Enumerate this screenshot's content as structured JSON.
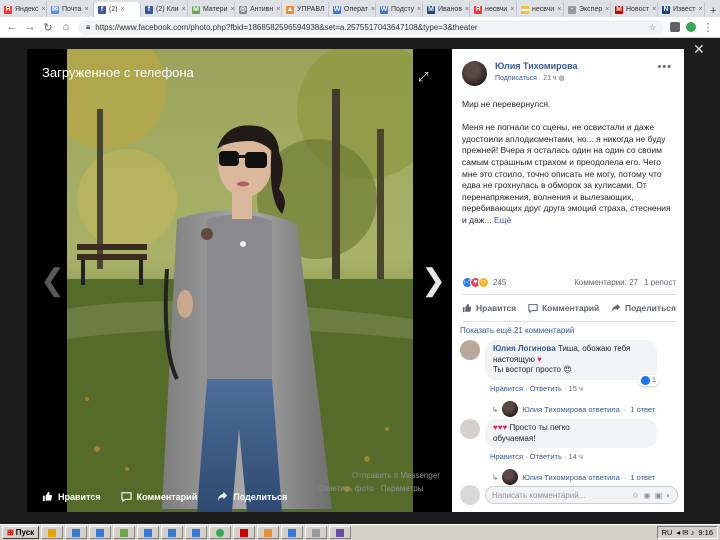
{
  "browser": {
    "tabs": [
      {
        "label": "Яндекс",
        "color": "#ff3333",
        "glyph": "Я"
      },
      {
        "label": "Почта",
        "color": "#5c8ee6",
        "glyph": "✉"
      },
      {
        "label": "(2)",
        "color": "#3b5998",
        "glyph": "f",
        "active": true
      },
      {
        "label": "(2) Кли",
        "color": "#3b5998",
        "glyph": "f"
      },
      {
        "label": "Матери",
        "color": "#6aa84f",
        "glyph": "М"
      },
      {
        "label": "Антивн",
        "color": "#888888",
        "glyph": "◎"
      },
      {
        "label": "УПРАВЛ",
        "color": "#e69138",
        "glyph": "▲"
      },
      {
        "label": "Операт",
        "color": "#3c78d8",
        "glyph": "W"
      },
      {
        "label": "Подсту",
        "color": "#3c78d8",
        "glyph": "W"
      },
      {
        "label": "Иванов",
        "color": "#1c4587",
        "glyph": "M"
      },
      {
        "label": "несвчи",
        "color": "#ff3333",
        "glyph": "Я"
      },
      {
        "label": "несвчи",
        "color": "#f1c232",
        "glyph": "▬"
      },
      {
        "label": "Экспер",
        "color": "#999999",
        "glyph": "·"
      },
      {
        "label": "Новост",
        "color": "#cc0000",
        "glyph": "M"
      },
      {
        "label": "Извест",
        "color": "#1c4587",
        "glyph": "N"
      }
    ],
    "url": "https://www.facebook.com/photo.php?fbid=1868582596594938&set=a.2575517043647108&type=3&theater"
  },
  "viewer": {
    "album_title": "Загруженное с телефона",
    "actions": {
      "like": "Нравится",
      "comment": "Комментарий",
      "share": "Поделиться"
    },
    "meta_send": "Отправить в Messenger",
    "meta_tag": "Отметить фото",
    "meta_options": "Параметры"
  },
  "post": {
    "author": "Юлия Тихомирова",
    "subscribe": "Подписаться",
    "time": "21 ч",
    "paragraph1": "Мир не перевернулся.",
    "paragraph2": "Меня не погнали со сцены, не освистали и даже удостоили аплодисментами, но... я никогда не буду прежней! Вчера я осталась один на один со своим самым страшным страхом и преодолела его. Чего мне это стоило, точно описать не могу, потому что едва не грохнулась в обморок за кулисами. От перенапряжения, волнения и вылезающих, перебивающих друг друга эмоций страха, стеснения и даж...",
    "more_link": "Ещё",
    "reactions_count": "245",
    "comments_count": "Комментарии: 27",
    "reposts_count": "1 репост",
    "actions": {
      "like": "Нравится",
      "comment": "Комментарий",
      "share": "Поделиться"
    }
  },
  "comments": {
    "show_more": "Показать ещё 21 комментарий",
    "items": [
      {
        "name": "Юлия Логинова",
        "text1": "Тиша, обожаю тебя настоящую",
        "text2": "Ты восторг просто",
        "like_count": "1",
        "reply_link": "Нравится",
        "answer_link": "Ответить",
        "time": "15 ч",
        "reply_author": "Юлия Тихомирова ответила",
        "reply_count": "1 ответ"
      },
      {
        "name": "",
        "text1": "Просто ты пегко",
        "text2": "обучаемая!",
        "reply_link": "Нравится",
        "answer_link": "Ответить",
        "time": "14 ч",
        "reply_author": "Юлия Тихомирова ответила",
        "reply_count": "1 ответ"
      }
    ],
    "input_placeholder": "Написать комментарий..."
  },
  "taskbar": {
    "start_label": "Пуск",
    "lang": "RU",
    "clock": "9:16"
  }
}
